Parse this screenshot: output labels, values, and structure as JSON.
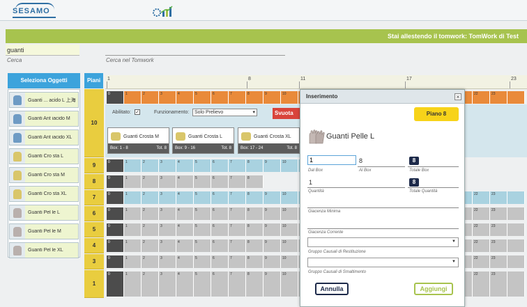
{
  "brand": {
    "logo": "SESAMO"
  },
  "header": {
    "title": "Stai allestendo il tomwork: TomWork di Test"
  },
  "search": {
    "value": "guanti",
    "label": "Cerca",
    "tomwork_label": "Cerca nel Tomwork"
  },
  "sidebar": {
    "title": "Seleziona Oggetti",
    "items": [
      {
        "label": "Guanti ... acido L 上海",
        "icon": "glove-blue-icon"
      },
      {
        "label": "Guanti Ant iacido M",
        "icon": "glove-blue-icon"
      },
      {
        "label": "Guanti Ant iacido XL",
        "icon": "glove-blue-icon"
      },
      {
        "label": "Guanti Cro sta L",
        "icon": "glove-yellow-icon"
      },
      {
        "label": "Guanti Cro sta M",
        "icon": "glove-yellow-icon"
      },
      {
        "label": "Guanti Cro sta XL",
        "icon": "glove-yellow-icon"
      },
      {
        "label": "Guanti Pel le L",
        "icon": "glove-gray-icon"
      },
      {
        "label": "Guanti Pel le M",
        "icon": "glove-gray-icon"
      },
      {
        "label": "Guanti Pel le XL",
        "icon": "glove-gray-icon"
      }
    ]
  },
  "floors": {
    "header": "Piani",
    "labels": [
      "10",
      "9",
      "8",
      "7",
      "6",
      "5",
      "4",
      "3",
      "1"
    ]
  },
  "ruler": {
    "marks": [
      "1",
      "8",
      "11",
      "17",
      "23"
    ]
  },
  "floor10": {
    "enabled_label": "Abilitato:",
    "enabled_check": "✓",
    "mode_label": "Funzionamento:",
    "mode_value": "Solo Prelievo",
    "empty_button": "Svuota",
    "boxes": [
      {
        "name": "Guanti Crosta M",
        "range": "Box: 1 - 8",
        "total": "Tot. 8"
      },
      {
        "name": "Guanti Crosta L",
        "range": "Box: 9 - 16",
        "total": "Tot. 8"
      },
      {
        "name": "Guanti Crosta XL",
        "range": "Box: 17 - 24",
        "total": "Tot. 8"
      }
    ]
  },
  "modal": {
    "title": "Inserimento",
    "close": "×",
    "floor_badge": "Piano 8",
    "product": "Guanti Pelle L",
    "dal_box_value": "1",
    "dal_box_label": "Dal Box",
    "al_box_value": "8",
    "al_box_label": "Al Box",
    "totale_box_value": "8",
    "totale_box_label": "Totale Box",
    "quantita_value": "1",
    "quantita_label": "Quantità",
    "totale_quantita_value": "8",
    "totale_quantita_label": "Totale Quantità",
    "giacenza_minima_label": "Giacenza Minima",
    "giacenza_corrente_label": "Giacenza Corrente",
    "gruppo_restituzione_label": "Gruppo Causali di Restituzione",
    "gruppo_smaltimento_label": "Gruppo Causali di Smaltimento",
    "cancel": "Annulla",
    "add": "Aggiungi"
  },
  "colors": {
    "accent_green": "#a7c34e",
    "accent_blue": "#3ca3dc",
    "floor_yellow": "#e9cd3f",
    "danger": "#d9443b",
    "badge_dark": "#1d2a4a"
  }
}
